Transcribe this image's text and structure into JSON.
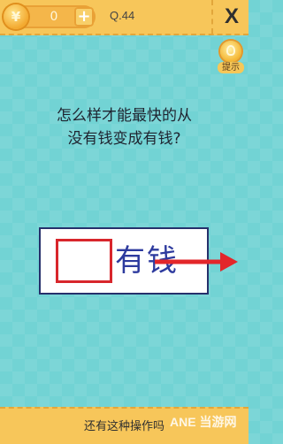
{
  "header": {
    "coin_symbol": "¥",
    "coin_count": "0",
    "add_symbol": "+",
    "level": "Q.44",
    "close_symbol": "X"
  },
  "hint": {
    "label": "提示"
  },
  "question": {
    "line1": "怎么样才能最快的从",
    "line2": "没有钱变成有钱?"
  },
  "answer_card": {
    "word": "有钱"
  },
  "footer": {
    "text": "还有这种操作吗",
    "watermark": "ANE 当游网"
  },
  "colors": {
    "background": "#72d3d4",
    "bar": "#f7c65a",
    "box_border": "#d8262c",
    "arrow": "#e3262a",
    "word": "#2d3a9e"
  }
}
